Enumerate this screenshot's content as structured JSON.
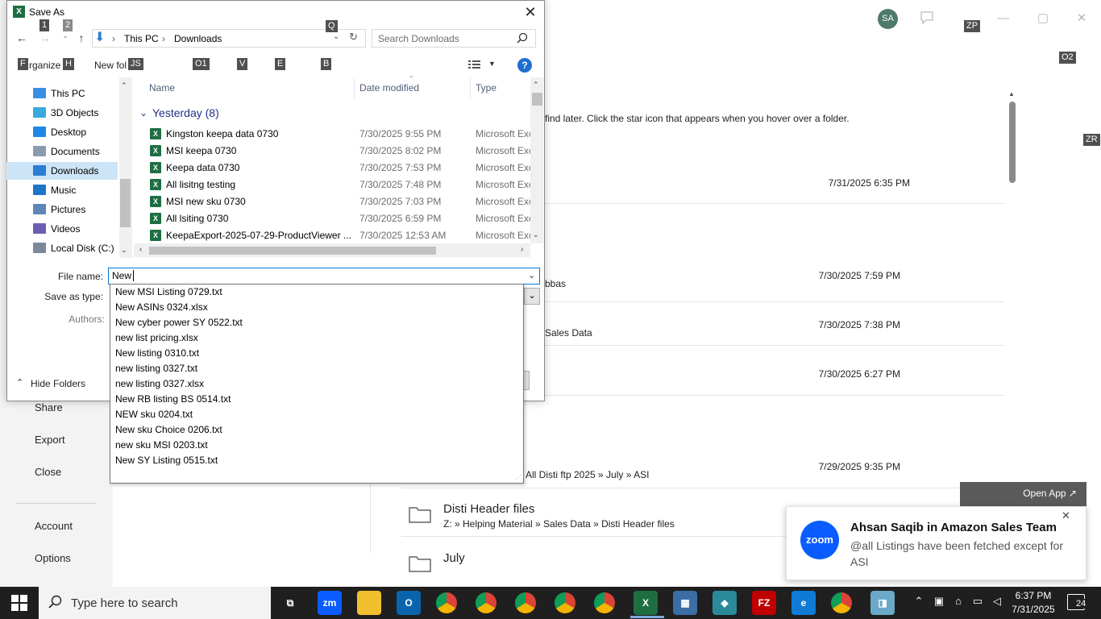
{
  "backstage": {
    "nav": [
      "Share",
      "Export",
      "Close",
      "Account",
      "Options"
    ],
    "hint_text": "find later. Click the star icon that appears when you hover over a folder.",
    "rows": [
      {
        "line1": "",
        "line2": "",
        "date": "7/31/2025 6:35 PM"
      },
      {
        "line1": "",
        "line2": "bbas",
        "date": "7/30/2025 7:59 PM"
      },
      {
        "line1": "",
        "line2": "Sales Data",
        "date": "7/30/2025 7:38 PM"
      },
      {
        "line1": "",
        "line2": "",
        "date": "7/30/2025 6:27 PM"
      },
      {
        "line1": "",
        "line2": "All Disti ftp 2025 » July » ASI",
        "date": "7/29/2025 9:35 PM"
      }
    ],
    "folder1_name": "Disti Header files",
    "folder1_path": "Z: » Helping Material » Sales Data » Disti Header files",
    "folder2_name": "July",
    "avatar_initials": "SA"
  },
  "keytips": {
    "k1": "1",
    "k2": "2",
    "q": "Q",
    "f": "F",
    "h": "H",
    "js": "JS",
    "o1": "O1",
    "v": "V",
    "e": "E",
    "b": "B",
    "zp": "ZP",
    "o2": "O2",
    "zr": "ZR"
  },
  "dialog": {
    "title": "Save As",
    "breadcrumb": [
      "This PC",
      "Downloads"
    ],
    "search_placeholder": "Search Downloads",
    "organize_label": "rganize",
    "new_folder_label": "New fol",
    "help_glyph": "?",
    "tree": [
      {
        "label": "This PC",
        "icon": "this-pc-icon",
        "color": "#3a8ee6"
      },
      {
        "label": "3D Objects",
        "icon": "3d-objects-icon",
        "color": "#39a9dc"
      },
      {
        "label": "Desktop",
        "icon": "desktop-icon",
        "color": "#1e88e5"
      },
      {
        "label": "Documents",
        "icon": "documents-icon",
        "color": "#8a9bb0"
      },
      {
        "label": "Downloads",
        "icon": "downloads-icon",
        "color": "#2b7cd3",
        "selected": true
      },
      {
        "label": "Music",
        "icon": "music-icon",
        "color": "#1e74c6"
      },
      {
        "label": "Pictures",
        "icon": "pictures-icon",
        "color": "#5b87b8"
      },
      {
        "label": "Videos",
        "icon": "videos-icon",
        "color": "#6b5fb5"
      },
      {
        "label": "Local Disk (C:)",
        "icon": "local-disk-icon",
        "color": "#7a8a99"
      }
    ],
    "columns": {
      "name": "Name",
      "date": "Date modified",
      "type": "Type"
    },
    "group_label": "Yesterday (8)",
    "files": [
      {
        "name": "Kingston keepa data 0730",
        "date": "7/30/2025 9:55 PM",
        "type": "Microsoft Excel"
      },
      {
        "name": "MSI keepa 0730",
        "date": "7/30/2025 8:02 PM",
        "type": "Microsoft Excel"
      },
      {
        "name": "Keepa data 0730",
        "date": "7/30/2025 7:53 PM",
        "type": "Microsoft Excel"
      },
      {
        "name": "All lisitng testing",
        "date": "7/30/2025 7:48 PM",
        "type": "Microsoft Excel"
      },
      {
        "name": "MSI new sku 0730",
        "date": "7/30/2025 7:03 PM",
        "type": "Microsoft Excel"
      },
      {
        "name": "All lsiting 0730",
        "date": "7/30/2025 6:59 PM",
        "type": "Microsoft Excel"
      },
      {
        "name": "KeepaExport-2025-07-29-ProductViewer ...",
        "date": "7/30/2025 12:53 AM",
        "type": "Microsoft Excel"
      }
    ],
    "file_name_label": "File name:",
    "file_name_value": "New ",
    "save_as_type_label": "Save as type:",
    "authors_label": "Authors:",
    "hide_folders_label": "Hide Folders",
    "suggestions": [
      "New  MSI Listing 0729.txt",
      "New ASINs 0324.xlsx",
      "New cyber power SY 0522.txt",
      "new list pricing.xlsx",
      "New listing 0310.txt",
      "new listing 0327.txt",
      "new listing 0327.xlsx",
      "New RB listing BS 0514.txt",
      "NEW sku 0204.txt",
      "New sku Choice 0206.txt",
      "new sku MSI 0203.txt",
      "New SY Listing 0515.txt"
    ]
  },
  "toast": {
    "open_app": "Open App ↗",
    "logo": "zoom",
    "title": "Ahsan Saqib in Amazon Sales Team",
    "message": "@all Listings have been fetched except for ASI"
  },
  "taskbar": {
    "search_placeholder": "Type here to search",
    "time": "6:37 PM",
    "date": "7/31/2025",
    "notification_count": "24",
    "apps": [
      {
        "name": "task-view-icon",
        "label": "⧉",
        "color": "#1f1f1f"
      },
      {
        "name": "zoom-icon",
        "label": "zm",
        "color": "#0b5cff"
      },
      {
        "name": "file-explorer-icon",
        "label": "",
        "color": "#f2c02e"
      },
      {
        "name": "outlook-icon",
        "label": "O",
        "color": "#0a64ad"
      },
      {
        "name": "chrome-icon-1",
        "label": "",
        "color": "#db4437"
      },
      {
        "name": "chrome-icon-2",
        "label": "",
        "color": "#db4437"
      },
      {
        "name": "chrome-icon-3",
        "label": "",
        "color": "#db4437"
      },
      {
        "name": "chrome-icon-4",
        "label": "",
        "color": "#db4437"
      },
      {
        "name": "chrome-icon-5",
        "label": "",
        "color": "#db4437"
      },
      {
        "name": "excel-icon",
        "label": "X",
        "color": "#1d6f42"
      },
      {
        "name": "calculator-icon",
        "label": "▦",
        "color": "#3a6ea5"
      },
      {
        "name": "app-icon",
        "label": "◆",
        "color": "#2a8a9a"
      },
      {
        "name": "filezilla-icon",
        "label": "FZ",
        "color": "#bf0000"
      },
      {
        "name": "edge-icon",
        "label": "e",
        "color": "#0f7bd6"
      },
      {
        "name": "chrome-icon-6",
        "label": "",
        "color": "#db4437"
      },
      {
        "name": "notes-icon",
        "label": "◨",
        "color": "#6aa9c8"
      }
    ]
  }
}
